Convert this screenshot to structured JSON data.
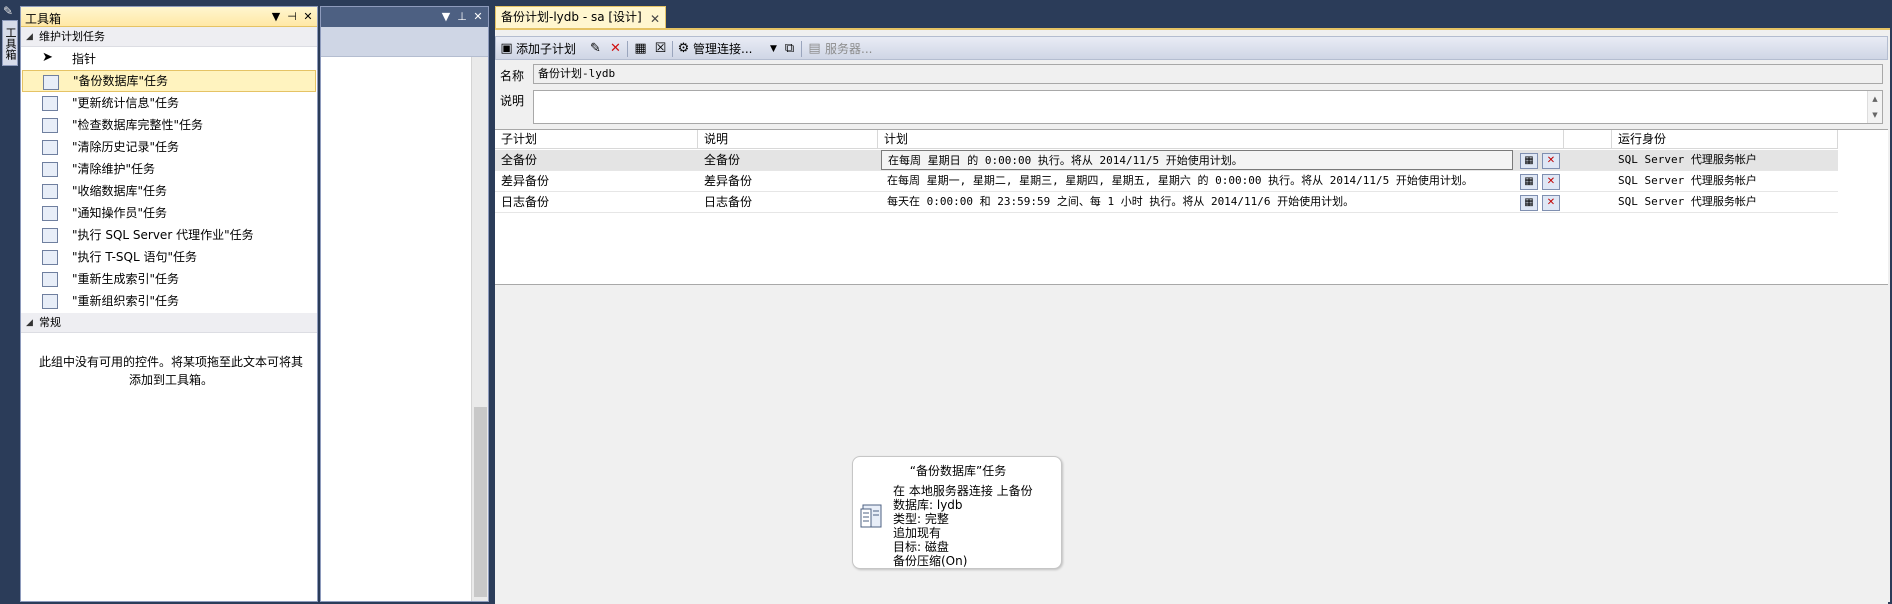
{
  "left_strip": {
    "tab_label": "工具箱"
  },
  "toolbox": {
    "title": "工具箱",
    "controls": {
      "dropdown": "▼",
      "pin": "⊣",
      "close": "✕"
    },
    "sections": [
      {
        "label": "维护计划任务",
        "items": [
          {
            "label": "指针",
            "icon": "pointer-icon"
          },
          {
            "label": "\"备份数据库\"任务",
            "icon": "backup-database-icon"
          },
          {
            "label": "\"更新统计信息\"任务",
            "icon": "update-statistics-icon"
          },
          {
            "label": "\"检查数据库完整性\"任务",
            "icon": "check-integrity-icon"
          },
          {
            "label": "\"清除历史记录\"任务",
            "icon": "history-cleanup-icon"
          },
          {
            "label": "\"清除维护\"任务",
            "icon": "maintenance-cleanup-icon"
          },
          {
            "label": "\"收缩数据库\"任务",
            "icon": "shrink-database-icon"
          },
          {
            "label": "\"通知操作员\"任务",
            "icon": "notify-operator-icon"
          },
          {
            "label": "\"执行 SQL Server 代理作业\"任务",
            "icon": "agent-job-icon"
          },
          {
            "label": "\"执行 T-SQL 语句\"任务",
            "icon": "tsql-icon"
          },
          {
            "label": "\"重新生成索引\"任务",
            "icon": "rebuild-index-icon"
          },
          {
            "label": "\"重新组织索引\"任务",
            "icon": "reorganize-index-icon"
          }
        ]
      },
      {
        "label": "常规"
      }
    ],
    "empty_text_line1": "此组中没有可用的控件。将某项拖至此文本可将其",
    "empty_text_line2": "添加到工具箱。"
  },
  "middle_panel": {
    "controls": {
      "dropdown": "▼",
      "pin": "⊥",
      "close": "✕"
    }
  },
  "document_tab": {
    "title": "备份计划-lydb - sa [设计]",
    "close": "✕"
  },
  "toolbar": {
    "add_subplan": "添加子计划",
    "manage_connections": "管理连接...",
    "servers": "服务器..."
  },
  "form": {
    "name_label": "名称",
    "name_value": "备份计划-lydb",
    "description_label": "说明",
    "description_value": ""
  },
  "grid": {
    "headers": {
      "subplan": "子计划",
      "description": "说明",
      "schedule": "计划",
      "run_as": "运行身份"
    },
    "rows": [
      {
        "subplan": "全备份",
        "description": "全备份",
        "schedule": "在每周 星期日 的 0:00:00 执行。将从 2014/11/5 开始使用计划。",
        "run_as": "SQL Server 代理服务帐户"
      },
      {
        "subplan": "差异备份",
        "description": "差异备份",
        "schedule": "在每周 星期一, 星期二, 星期三, 星期四, 星期五, 星期六 的 0:00:00 执行。将从 2014/11/5 开始使用计划。",
        "run_as": "SQL Server 代理服务帐户"
      },
      {
        "subplan": "日志备份",
        "description": "日志备份",
        "schedule": "每天在 0:00:00 和 23:59:59 之间、每 1 小时 执行。将从 2014/11/6 开始使用计划。",
        "run_as": "SQL Server 代理服务帐户"
      }
    ]
  },
  "task_box": {
    "title": "“备份数据库”任务",
    "lines": [
      "在 本地服务器连接 上备份",
      "数据库: lydb",
      "类型: 完整",
      "追加现有",
      "目标: 磁盘",
      "备份压缩(On)"
    ]
  }
}
